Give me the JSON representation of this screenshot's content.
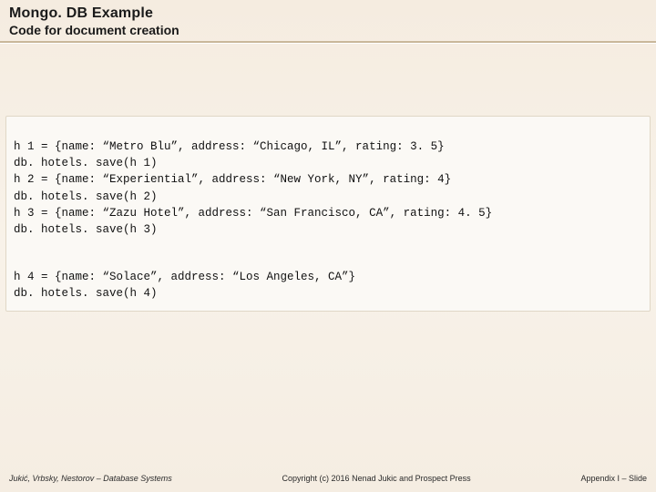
{
  "header": {
    "title": "Mongo. DB Example",
    "subtitle": "Code for document creation"
  },
  "code": {
    "block1_line1": "h 1 = {name: “Metro Blu”, address: “Chicago, IL”, rating: 3. 5}",
    "block1_line2": "db. hotels. save(h 1)",
    "block1_line3": "h 2 = {name: “Experiential”, address: “New York, NY”, rating: 4}",
    "block1_line4": "db. hotels. save(h 2)",
    "block1_line5": "h 3 = {name: “Zazu Hotel”, address: “San Francisco, CA”, rating: 4. 5}",
    "block1_line6": "db. hotels. save(h 3)",
    "block2_line1": "h 4 = {name: “Solace”, address: “Los Angeles, CA”}",
    "block2_line2": "db. hotels. save(h 4)"
  },
  "footer": {
    "left": "Jukić, Vrbsky, Nestorov – Database Systems",
    "center": "Copyright (c) 2016 Nenad Jukic and Prospect Press",
    "right": "Appendix I – Slide"
  }
}
